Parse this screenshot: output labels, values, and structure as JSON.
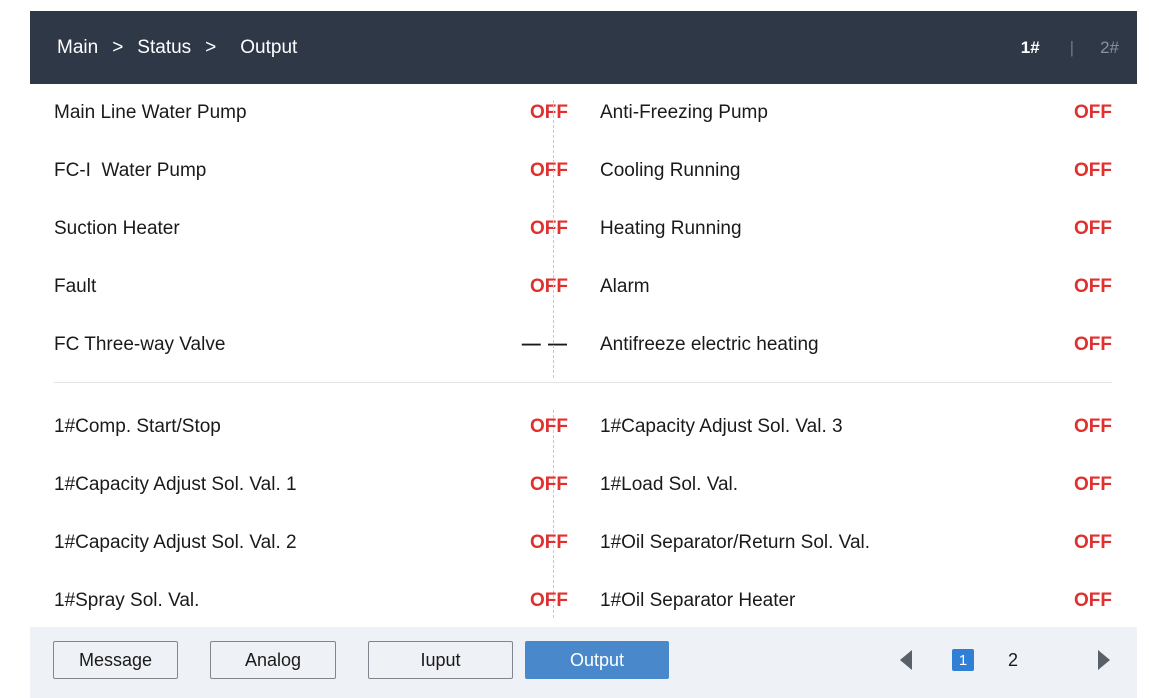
{
  "header": {
    "breadcrumb": [
      "Main",
      "Status",
      "Output"
    ],
    "separator": ">",
    "units": [
      "1#",
      "2#"
    ],
    "unit_divider": "|",
    "active_unit": "1#"
  },
  "general_outputs": [
    {
      "left_label": "Main Line Water Pump",
      "left_value": "OFF",
      "right_label": "Anti-Freezing Pump",
      "right_value": "OFF"
    },
    {
      "left_label": "FC-I  Water Pump",
      "left_value": "OFF",
      "right_label": "Cooling Running",
      "right_value": "OFF"
    },
    {
      "left_label": "Suction Heater",
      "left_value": "OFF",
      "right_label": "Heating Running",
      "right_value": "OFF"
    },
    {
      "left_label": "Fault",
      "left_value": "OFF",
      "right_label": "Alarm",
      "right_value": "OFF"
    },
    {
      "left_label": "FC Three-way Valve",
      "left_value": "— —",
      "right_label": "Antifreeze electric heating",
      "right_value": "OFF"
    }
  ],
  "compressor_outputs": [
    {
      "left_label": "1#Comp. Start/Stop",
      "left_value": "OFF",
      "right_label": "1#Capacity Adjust Sol. Val. 3",
      "right_value": "OFF"
    },
    {
      "left_label": "1#Capacity Adjust Sol. Val. 1",
      "left_value": "OFF",
      "right_label": "1#Load Sol. Val.",
      "right_value": "OFF"
    },
    {
      "left_label": "1#Capacity Adjust Sol. Val. 2",
      "left_value": "OFF",
      "right_label": "1#Oil Separator/Return Sol. Val.",
      "right_value": "OFF"
    },
    {
      "left_label": "1#Spray Sol. Val.",
      "left_value": "OFF",
      "right_label": "1#Oil Separator Heater",
      "right_value": "OFF"
    }
  ],
  "footer": {
    "tabs": [
      "Message",
      "Analog",
      "Iuput",
      "Output"
    ],
    "active_tab": "Output",
    "pages": [
      "1",
      "2"
    ],
    "current_page": "1"
  },
  "colors": {
    "header_bg": "#2f3847",
    "off_value": "#e03030",
    "active_tab_bg": "#4a88cc",
    "footer_bg": "#eef1f5"
  },
  "icons": {
    "prev": "triangle-left-icon",
    "next": "triangle-right-icon"
  }
}
